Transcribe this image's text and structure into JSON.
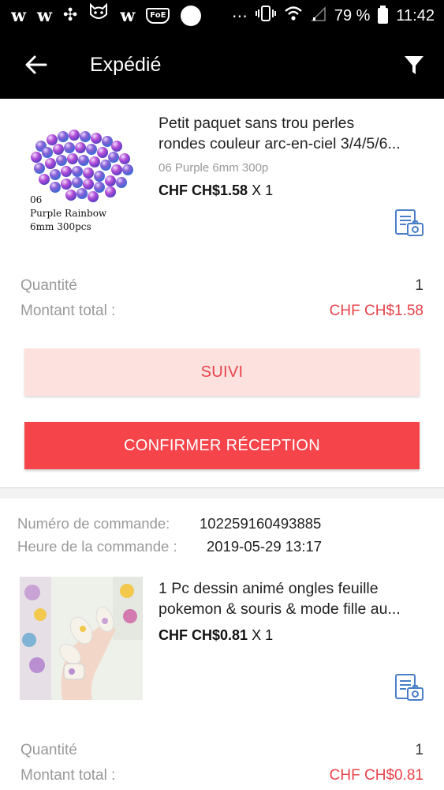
{
  "status_bar": {
    "battery": "79 %",
    "time": "11:42",
    "left_icons": [
      "w",
      "w",
      "✣",
      "🐱",
      "w",
      "FoE"
    ],
    "dots": "⋯"
  },
  "header": {
    "title": "Expédié",
    "back_icon": "arrow-left",
    "filter_icon": "funnel"
  },
  "orders": [
    {
      "product": {
        "title_line1": "Petit paquet sans trou perles",
        "title_line2": "rondes couleur arc-en-ciel 3/4/5/6...",
        "variant": "06 Purple 6mm 300p",
        "price": "CHF CH$1.58",
        "qty": "X 1",
        "thumb_caption_1": "06",
        "thumb_caption_2": "Purple Rainbow",
        "thumb_caption_3": "6mm 300pcs"
      },
      "quantity_label": "Quantité",
      "quantity_value": "1",
      "total_label": "Montant total :",
      "total_value": "CHF CH$1.58",
      "track_button": "SUIVI",
      "confirm_button": "CONFIRMER RÉCEPTION"
    },
    {
      "order_number_label": "Numéro de commande:",
      "order_number_value": "102259160493885",
      "order_time_label": "Heure de la commande :",
      "order_time_value": "2019-05-29 13:17",
      "product": {
        "title_line1": "1 Pc dessin animé ongles feuille",
        "title_line2": "pokemon & souris & mode fille au...",
        "price": "CHF CH$0.81",
        "qty": "X 1"
      },
      "quantity_label": "Quantité",
      "quantity_value": "1",
      "total_label": "Montant total :",
      "total_value": "CHF CH$0.81"
    }
  ],
  "colors": {
    "accent": "#f6444b",
    "accent_light": "#fce1de",
    "header_bg": "#000000"
  }
}
